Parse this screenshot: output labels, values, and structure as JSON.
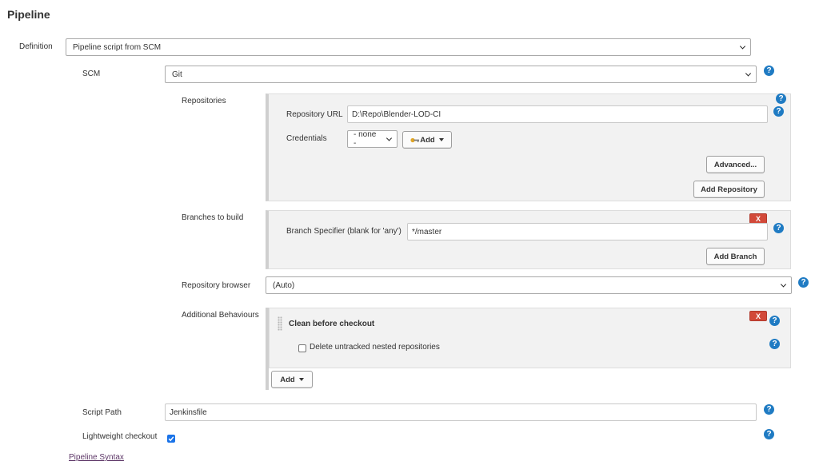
{
  "section": {
    "title": "Pipeline"
  },
  "definition": {
    "label": "Definition",
    "value": "Pipeline script from SCM"
  },
  "scm": {
    "label": "SCM",
    "value": "Git"
  },
  "repositories": {
    "label": "Repositories",
    "url_label": "Repository URL",
    "url_value": "D:\\Repo\\Blender-LOD-CI",
    "credentials_label": "Credentials",
    "credentials_value": "- none -",
    "add_label": "Add",
    "advanced_label": "Advanced...",
    "add_repository_label": "Add Repository"
  },
  "branches": {
    "label": "Branches to build",
    "specifier_label": "Branch Specifier (blank for 'any')",
    "specifier_value": "*/master",
    "delete_label": "X",
    "add_branch_label": "Add Branch"
  },
  "repo_browser": {
    "label": "Repository browser",
    "value": "(Auto)"
  },
  "behaviours": {
    "label": "Additional Behaviours",
    "item_title": "Clean before checkout",
    "delete_label": "X",
    "option_label": "Delete untracked nested repositories",
    "option_checked": false,
    "add_label": "Add"
  },
  "script_path": {
    "label": "Script Path",
    "value": "Jenkinsfile"
  },
  "lightweight": {
    "label": "Lightweight checkout",
    "checked": true
  },
  "footer": {
    "pipeline_syntax_label": "Pipeline Syntax"
  },
  "help": {
    "glyph": "?"
  },
  "colors": {
    "help": "#1f7bc3",
    "delete": "#d24939",
    "link": "#5c3566",
    "checkbox": "#1a73e8"
  }
}
